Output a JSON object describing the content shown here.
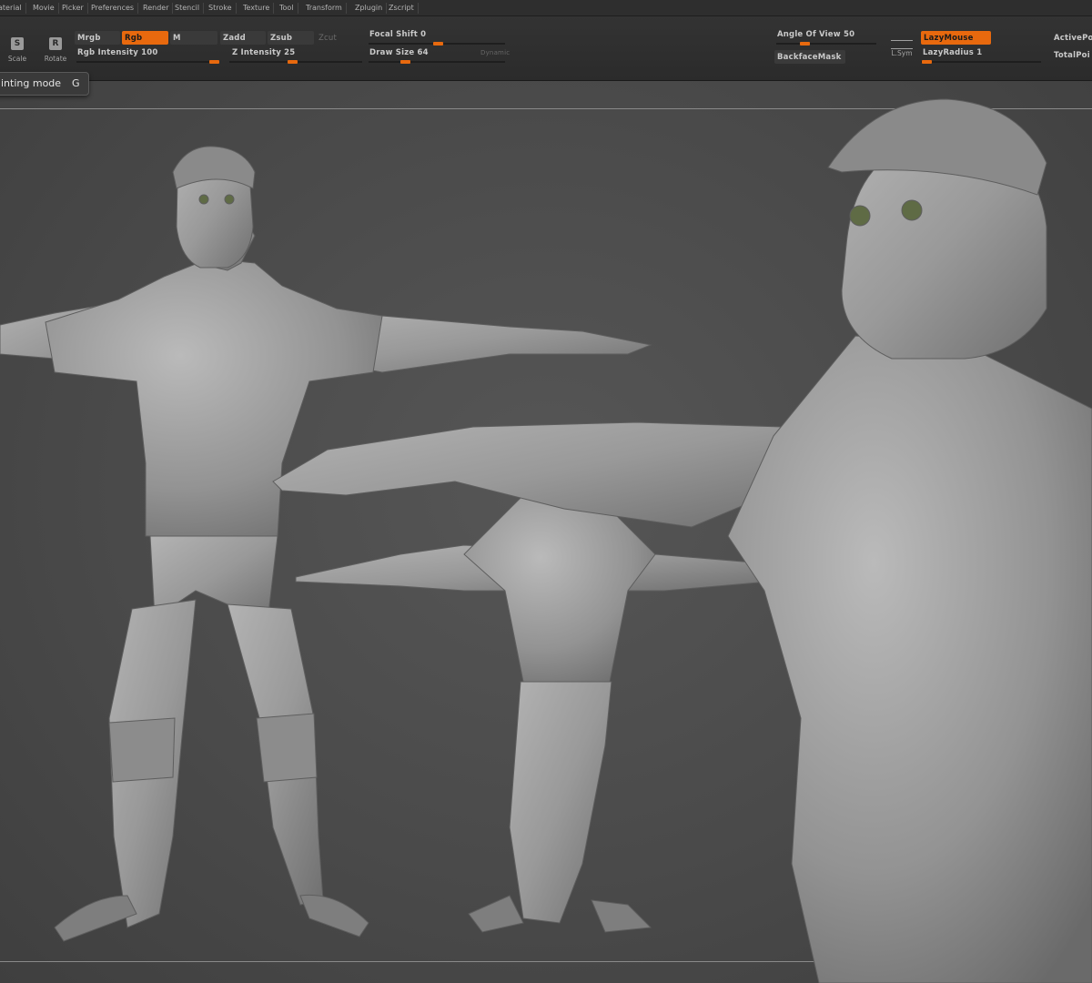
{
  "menu": [
    "aterial",
    "Movie",
    "Picker",
    "Preferences",
    "Render",
    "Stencil",
    "Stroke",
    "Texture",
    "Tool",
    "Transform",
    "Zplugin",
    "Zscript"
  ],
  "tools": {
    "scale": {
      "glyph": "S",
      "label": "Scale"
    },
    "rotate": {
      "glyph": "R",
      "label": "Rotate"
    },
    "mrgb": "Mrgb",
    "rgb": "Rgb",
    "m": "M",
    "zadd": "Zadd",
    "zsub": "Zsub",
    "zcut": "Zcut",
    "rgb_intensity": {
      "label": "Rgb Intensity 100",
      "value": 100,
      "max": 100
    },
    "z_intensity": {
      "label": "Z Intensity 25",
      "value": 25,
      "max": 100
    },
    "focal_shift": {
      "label": "Focal Shift 0",
      "value": 0
    },
    "draw_size": {
      "label": "Draw Size 64",
      "value": 64
    },
    "dynamic": "Dynamic",
    "angle_of_view": {
      "label": "Angle Of View 50",
      "value": 50
    },
    "backface_mask": "BackfaceMask",
    "lsym": "L.Sym",
    "lazy_mouse": "LazyMouse",
    "lazy_radius": {
      "label": "LazyRadius 1",
      "value": 1
    },
    "active_points": "ActivePo",
    "total_points": "TotalPoi"
  },
  "hint": {
    "text": "inting mode",
    "key": "G"
  },
  "colors": {
    "accent": "#e8690e",
    "background": "#484848",
    "clay": "#9c9c9c"
  }
}
